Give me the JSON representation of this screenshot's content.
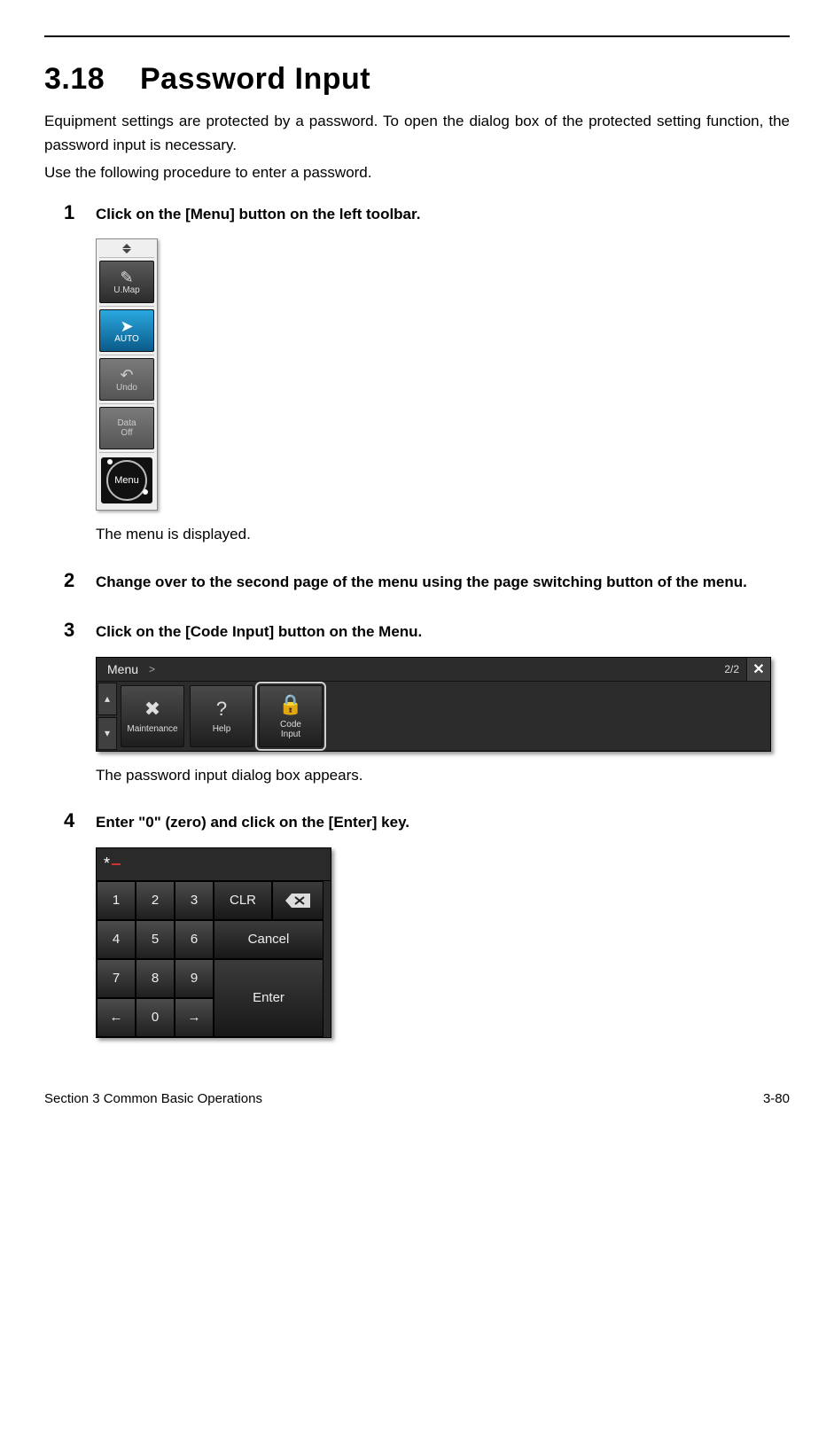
{
  "section_number": "3.18",
  "section_title": "Password Input",
  "intro_p1": "Equipment settings are protected by a password. To open the dialog box of the protected setting function, the password input is necessary.",
  "intro_p2": "Use the following procedure to enter a password.",
  "steps": [
    {
      "num": "1",
      "title": "Click on the [Menu] button on the left toolbar.",
      "after": "The menu is displayed."
    },
    {
      "num": "2",
      "title": "Change over to the second page of the menu using the page switching button of the menu."
    },
    {
      "num": "3",
      "title": "Click on the [Code Input] button on the Menu.",
      "after": "The password input dialog box appears."
    },
    {
      "num": "4",
      "title": "Enter \"0\" (zero) and click on the [Enter] key."
    }
  ],
  "toolbar": {
    "umap": "U.Map",
    "auto": "AUTO",
    "undo": "Undo",
    "dataoff_l1": "Data",
    "dataoff_l2": "Off",
    "menu": "Menu"
  },
  "menubar": {
    "title": "Menu",
    "chevron": ">",
    "page": "2/2",
    "close": "✕",
    "pager_up": "▴",
    "pager_dn": "▾",
    "items": [
      {
        "label": "Maintenance"
      },
      {
        "label": "Help"
      },
      {
        "label": "Code\nInput"
      }
    ]
  },
  "keypad": {
    "display": "*",
    "keys": {
      "k1": "1",
      "k2": "2",
      "k3": "3",
      "clr": "CLR",
      "k4": "4",
      "k5": "5",
      "k6": "6",
      "cancel": "Cancel",
      "k7": "7",
      "k8": "8",
      "k9": "9",
      "enter": "Enter",
      "left": "←",
      "k0": "0",
      "right": "→"
    }
  },
  "footer": {
    "left": "Section 3    Common Basic Operations",
    "right": "3-80"
  }
}
